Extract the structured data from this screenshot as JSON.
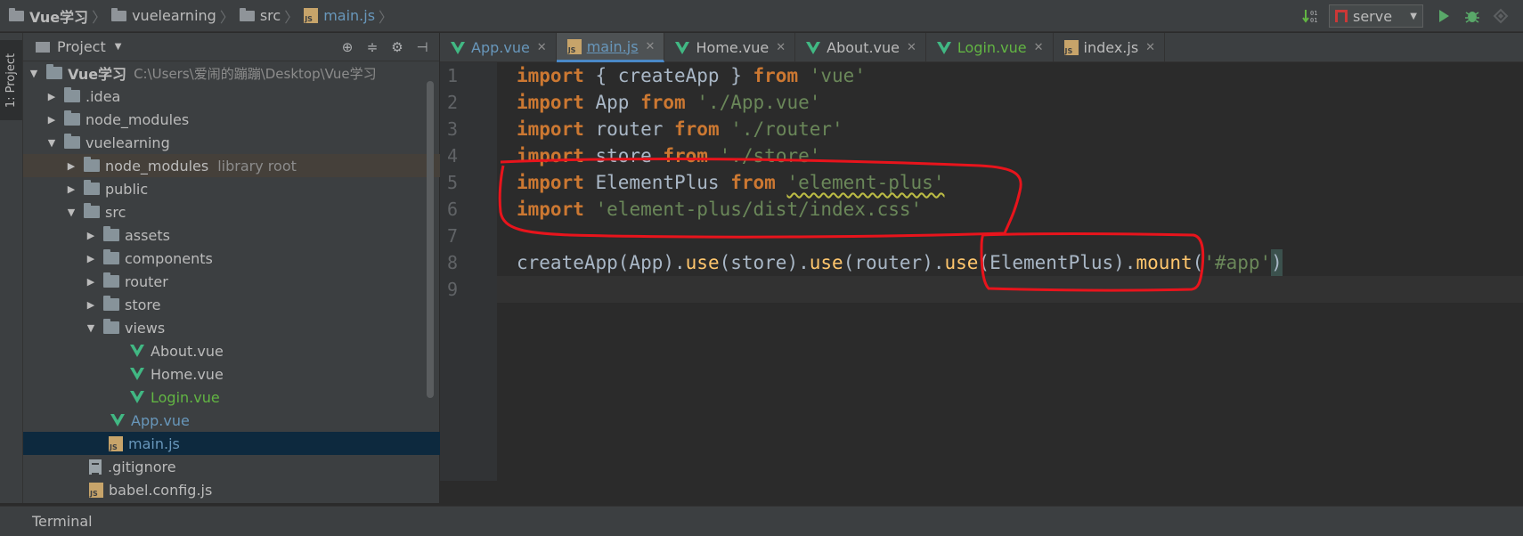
{
  "breadcrumb": {
    "project": "Vue学习",
    "folder1": "vuelearning",
    "folder2": "src",
    "file": "main.js"
  },
  "run": {
    "config": "serve"
  },
  "sidebar": {
    "stripe_label": "1: Project"
  },
  "project_panel": {
    "title": "Project",
    "tree": [
      {
        "label": "Vue学习",
        "note": "C:\\Users\\爱闹的蹦蹦\\Desktop\\Vue学习"
      },
      {
        "label": ".idea"
      },
      {
        "label": "node_modules"
      },
      {
        "label": "vuelearning"
      },
      {
        "label": "node_modules",
        "note": "library root"
      },
      {
        "label": "public"
      },
      {
        "label": "src"
      },
      {
        "label": "assets"
      },
      {
        "label": "components"
      },
      {
        "label": "router"
      },
      {
        "label": "store"
      },
      {
        "label": "views"
      },
      {
        "label": "About.vue"
      },
      {
        "label": "Home.vue"
      },
      {
        "label": "Login.vue"
      },
      {
        "label": "App.vue"
      },
      {
        "label": "main.js"
      },
      {
        "label": ".gitignore"
      },
      {
        "label": "babel.config.js"
      }
    ]
  },
  "editor": {
    "tabs": [
      {
        "label": "App.vue"
      },
      {
        "label": "main.js"
      },
      {
        "label": "Home.vue"
      },
      {
        "label": "About.vue"
      },
      {
        "label": "Login.vue"
      },
      {
        "label": "index.js"
      }
    ],
    "line_numbers": [
      "1",
      "2",
      "3",
      "4",
      "5",
      "6",
      "7",
      "8",
      "9"
    ],
    "code": {
      "import_kw": "import",
      "from_kw": "from",
      "l1_mid": " { createApp } ",
      "l1_str": "'vue'",
      "l2_mid": " App ",
      "l2_str": "'./App.vue'",
      "l3_mid": " router ",
      "l3_str": "'./router'",
      "l4_mid": " store ",
      "l4_str": "'./store'",
      "l5_mid": " ElementPlus ",
      "l5_str": "'element-plus'",
      "l6_str": "'element-plus/dist/index.css'",
      "l8_a": "createApp(App).",
      "use_fn": "use",
      "l8_b": "(store).",
      "l8_c": "(router).",
      "l8_d": "(ElementPlus).",
      "mount_fn": "mount",
      "l8_e": "(",
      "l8_str": "'#app'",
      "l8_f": ")"
    }
  },
  "bottom_bar": {
    "terminal_label": "Terminal"
  },
  "colors": {
    "keyword": "#cc7832",
    "string": "#6a8759",
    "function": "#ffc66d",
    "annotation": "#e8141c",
    "vue": "#41b883"
  }
}
